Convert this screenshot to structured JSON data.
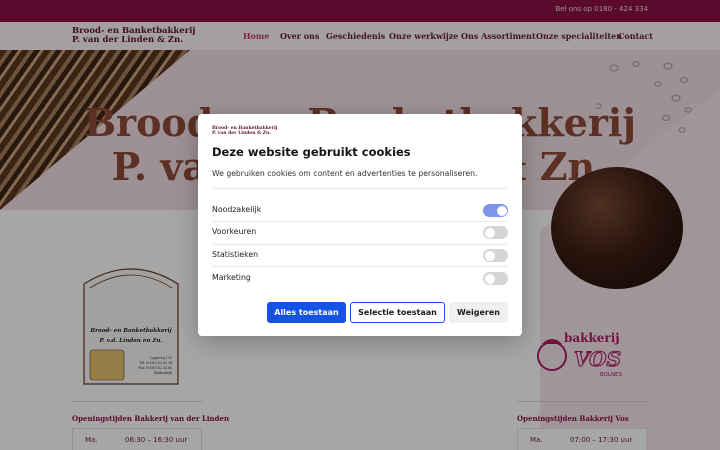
{
  "topbar": {
    "phone": "Bel ons op 0180 - 424 334"
  },
  "brand": {
    "line1": "Brood- en Banketbakkerij",
    "line2": "P. van der Linden & Zn."
  },
  "nav": [
    {
      "label": "Home",
      "active": true
    },
    {
      "label": "Over ons"
    },
    {
      "label": "Geschiedenis"
    },
    {
      "label": "Onze werkwijze"
    },
    {
      "label": "Ons Assortiment"
    },
    {
      "label": "Onze specialiteiten"
    },
    {
      "label": "Contact"
    }
  ],
  "hero": {
    "title_line1": "Brood- en Banketbakkerij",
    "title_line2": "P. van der Linden & Zn."
  },
  "badge_left": {
    "line1": "Brood- en Banketbakkerij",
    "line2": "P. v.d. Linden en Zn.",
    "addr1": "Lageweg 133",
    "addr2": "Tel: (0180) 42 43 34",
    "addr3": "Fax: (0180) 42 34 80",
    "addr4": "Ridderkerk"
  },
  "badge_right": {
    "word": "bakkerij",
    "name": "VOS",
    "town": "BOLNES"
  },
  "hours_left": {
    "title": "Openingstijden Bakkerij van der Linden",
    "day": "Ma.",
    "time": "06:30 – 16:30 uur"
  },
  "hours_right": {
    "title": "Openingstijden Bakkerij Vos",
    "day": "Ma.",
    "time": "07:00 – 17:30 uur"
  },
  "cookie_modal": {
    "logo_line1": "Brood- en Banketbakkerij",
    "logo_line2": "P. van der Linden & Zn.",
    "title": "Deze website gebruikt cookies",
    "description": "We gebruiken cookies om content en advertenties te personaliseren.",
    "options": [
      {
        "label": "Noodzakelijk",
        "enabled": true
      },
      {
        "label": "Voorkeuren",
        "enabled": false
      },
      {
        "label": "Statistieken",
        "enabled": false
      },
      {
        "label": "Marketing",
        "enabled": false
      }
    ],
    "buttons": {
      "accept_all": "Alles toestaan",
      "accept_selection": "Selectie toestaan",
      "deny": "Weigeren"
    }
  },
  "colors": {
    "brand": "#8b1146",
    "accent_link": "#c43b74",
    "primary_button": "#1552e6",
    "toggle_on": "#7f95ea"
  }
}
